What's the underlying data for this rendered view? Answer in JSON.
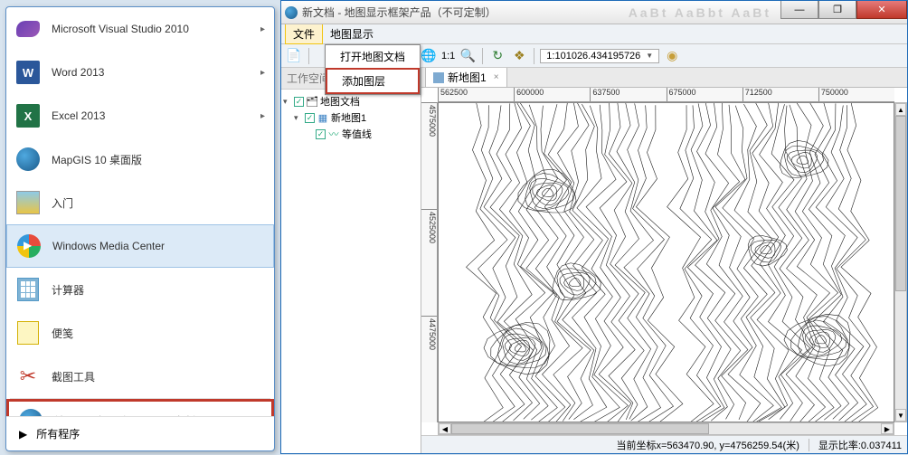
{
  "start_menu": {
    "items": [
      {
        "label": "Microsoft Visual Studio 2010",
        "icon": "vs",
        "has_arrow": true
      },
      {
        "label": "Word 2013",
        "icon": "word",
        "has_arrow": true
      },
      {
        "label": "Excel 2013",
        "icon": "excel",
        "has_arrow": true
      },
      {
        "label": "MapGIS 10 桌面版",
        "icon": "globe",
        "has_arrow": false
      },
      {
        "label": "入门",
        "icon": "intro",
        "has_arrow": false
      },
      {
        "label": "Windows Media Center",
        "icon": "wmc",
        "has_arrow": false,
        "selected": true
      },
      {
        "label": "计算器",
        "icon": "calc",
        "has_arrow": false
      },
      {
        "label": "便笺",
        "icon": "note",
        "has_arrow": false
      },
      {
        "label": "截图工具",
        "icon": "scissors",
        "has_arrow": false
      },
      {
        "label": "地图显示框架产品（不可定制）",
        "icon": "globe",
        "has_arrow": false,
        "highlighted": true
      }
    ],
    "all_programs": "所有程序"
  },
  "app": {
    "title": "新文档 - 地图显示框架产品（不可定制）",
    "menus": {
      "file": "文件",
      "view": "地图显示"
    },
    "file_dropdown": {
      "open_doc": "打开地图文档",
      "add_layer": "添加图层"
    },
    "toolbar": {
      "scale_ratio": "1:1",
      "scale_value": "1:101026.434195726"
    },
    "workspace_pane_title": "工作空间",
    "tree": {
      "root": "地图文档",
      "map": "新地图1",
      "layer": "等值线"
    },
    "doc_tab": "新地图1",
    "ruler_h": [
      "562500",
      "600000",
      "637500",
      "675000",
      "712500",
      "750000"
    ],
    "ruler_v": [
      "4575000",
      "4525000",
      "4475000"
    ],
    "status": {
      "coords": "当前坐标x=563470.90, y=4756259.54(米)",
      "scale": "显示比率:0.037411"
    }
  }
}
